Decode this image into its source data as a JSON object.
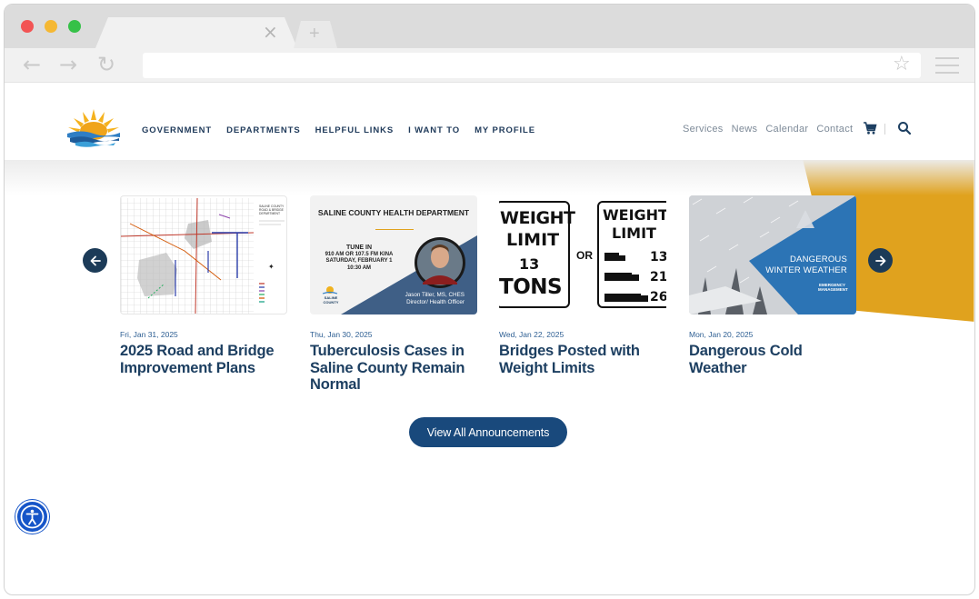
{
  "header": {
    "main_nav": [
      "GOVERNMENT",
      "DEPARTMENTS",
      "HELPFUL LINKS",
      "I WANT TO",
      "MY PROFILE"
    ],
    "util_nav": [
      "Services",
      "News",
      "Calendar",
      "Contact"
    ]
  },
  "cards": [
    {
      "date": "Fri, Jan 31, 2025",
      "title": "2025 Road and Bridge Improvement Plans",
      "image_legend": "SALINE COUNTY ROAD & BRIDGE DEPARTMENT"
    },
    {
      "date": "Thu, Jan 30, 2025",
      "title": "Tuberculosis Cases in Saline County Remain Normal",
      "image_heading": "SALINE COUNTY HEALTH DEPARTMENT",
      "image_tune": "TUNE IN",
      "image_station": "910 AM OR 107.5 FM KINA",
      "image_day": "SATURDAY, FEBRUARY 1",
      "image_time": "10:30 AM",
      "image_person": "Jason Tiller, MS, CHES",
      "image_role": "Director/ Health Officer",
      "image_logo": "SALINE COUNTY"
    },
    {
      "date": "Wed, Jan 22, 2025",
      "title": "Bridges Posted with Weight Limits",
      "sign_a": [
        "WEIGHT",
        "LIMIT",
        "13",
        "TONS"
      ],
      "sign_or": "OR",
      "sign_b": [
        "WEIGHT",
        "LIMIT",
        "13",
        "21",
        "26"
      ]
    },
    {
      "date": "Mon, Jan 20, 2025",
      "title": "Dangerous Cold Weather",
      "image_banner_1": "DANGEROUS",
      "image_banner_2": "WINTER WEATHER",
      "image_badge": "EMERGENCY MANAGEMENT"
    }
  ],
  "view_all_label": "View All Announcements",
  "colors": {
    "navy": "#1d3f61",
    "button": "#19497c",
    "accent_orange": "#e0a21e",
    "accessibility_blue": "#1655c8"
  },
  "icons": [
    "cart-icon",
    "search-icon",
    "arrow-left-icon",
    "arrow-right-icon",
    "accessibility-icon",
    "star-icon",
    "menu-icon"
  ]
}
